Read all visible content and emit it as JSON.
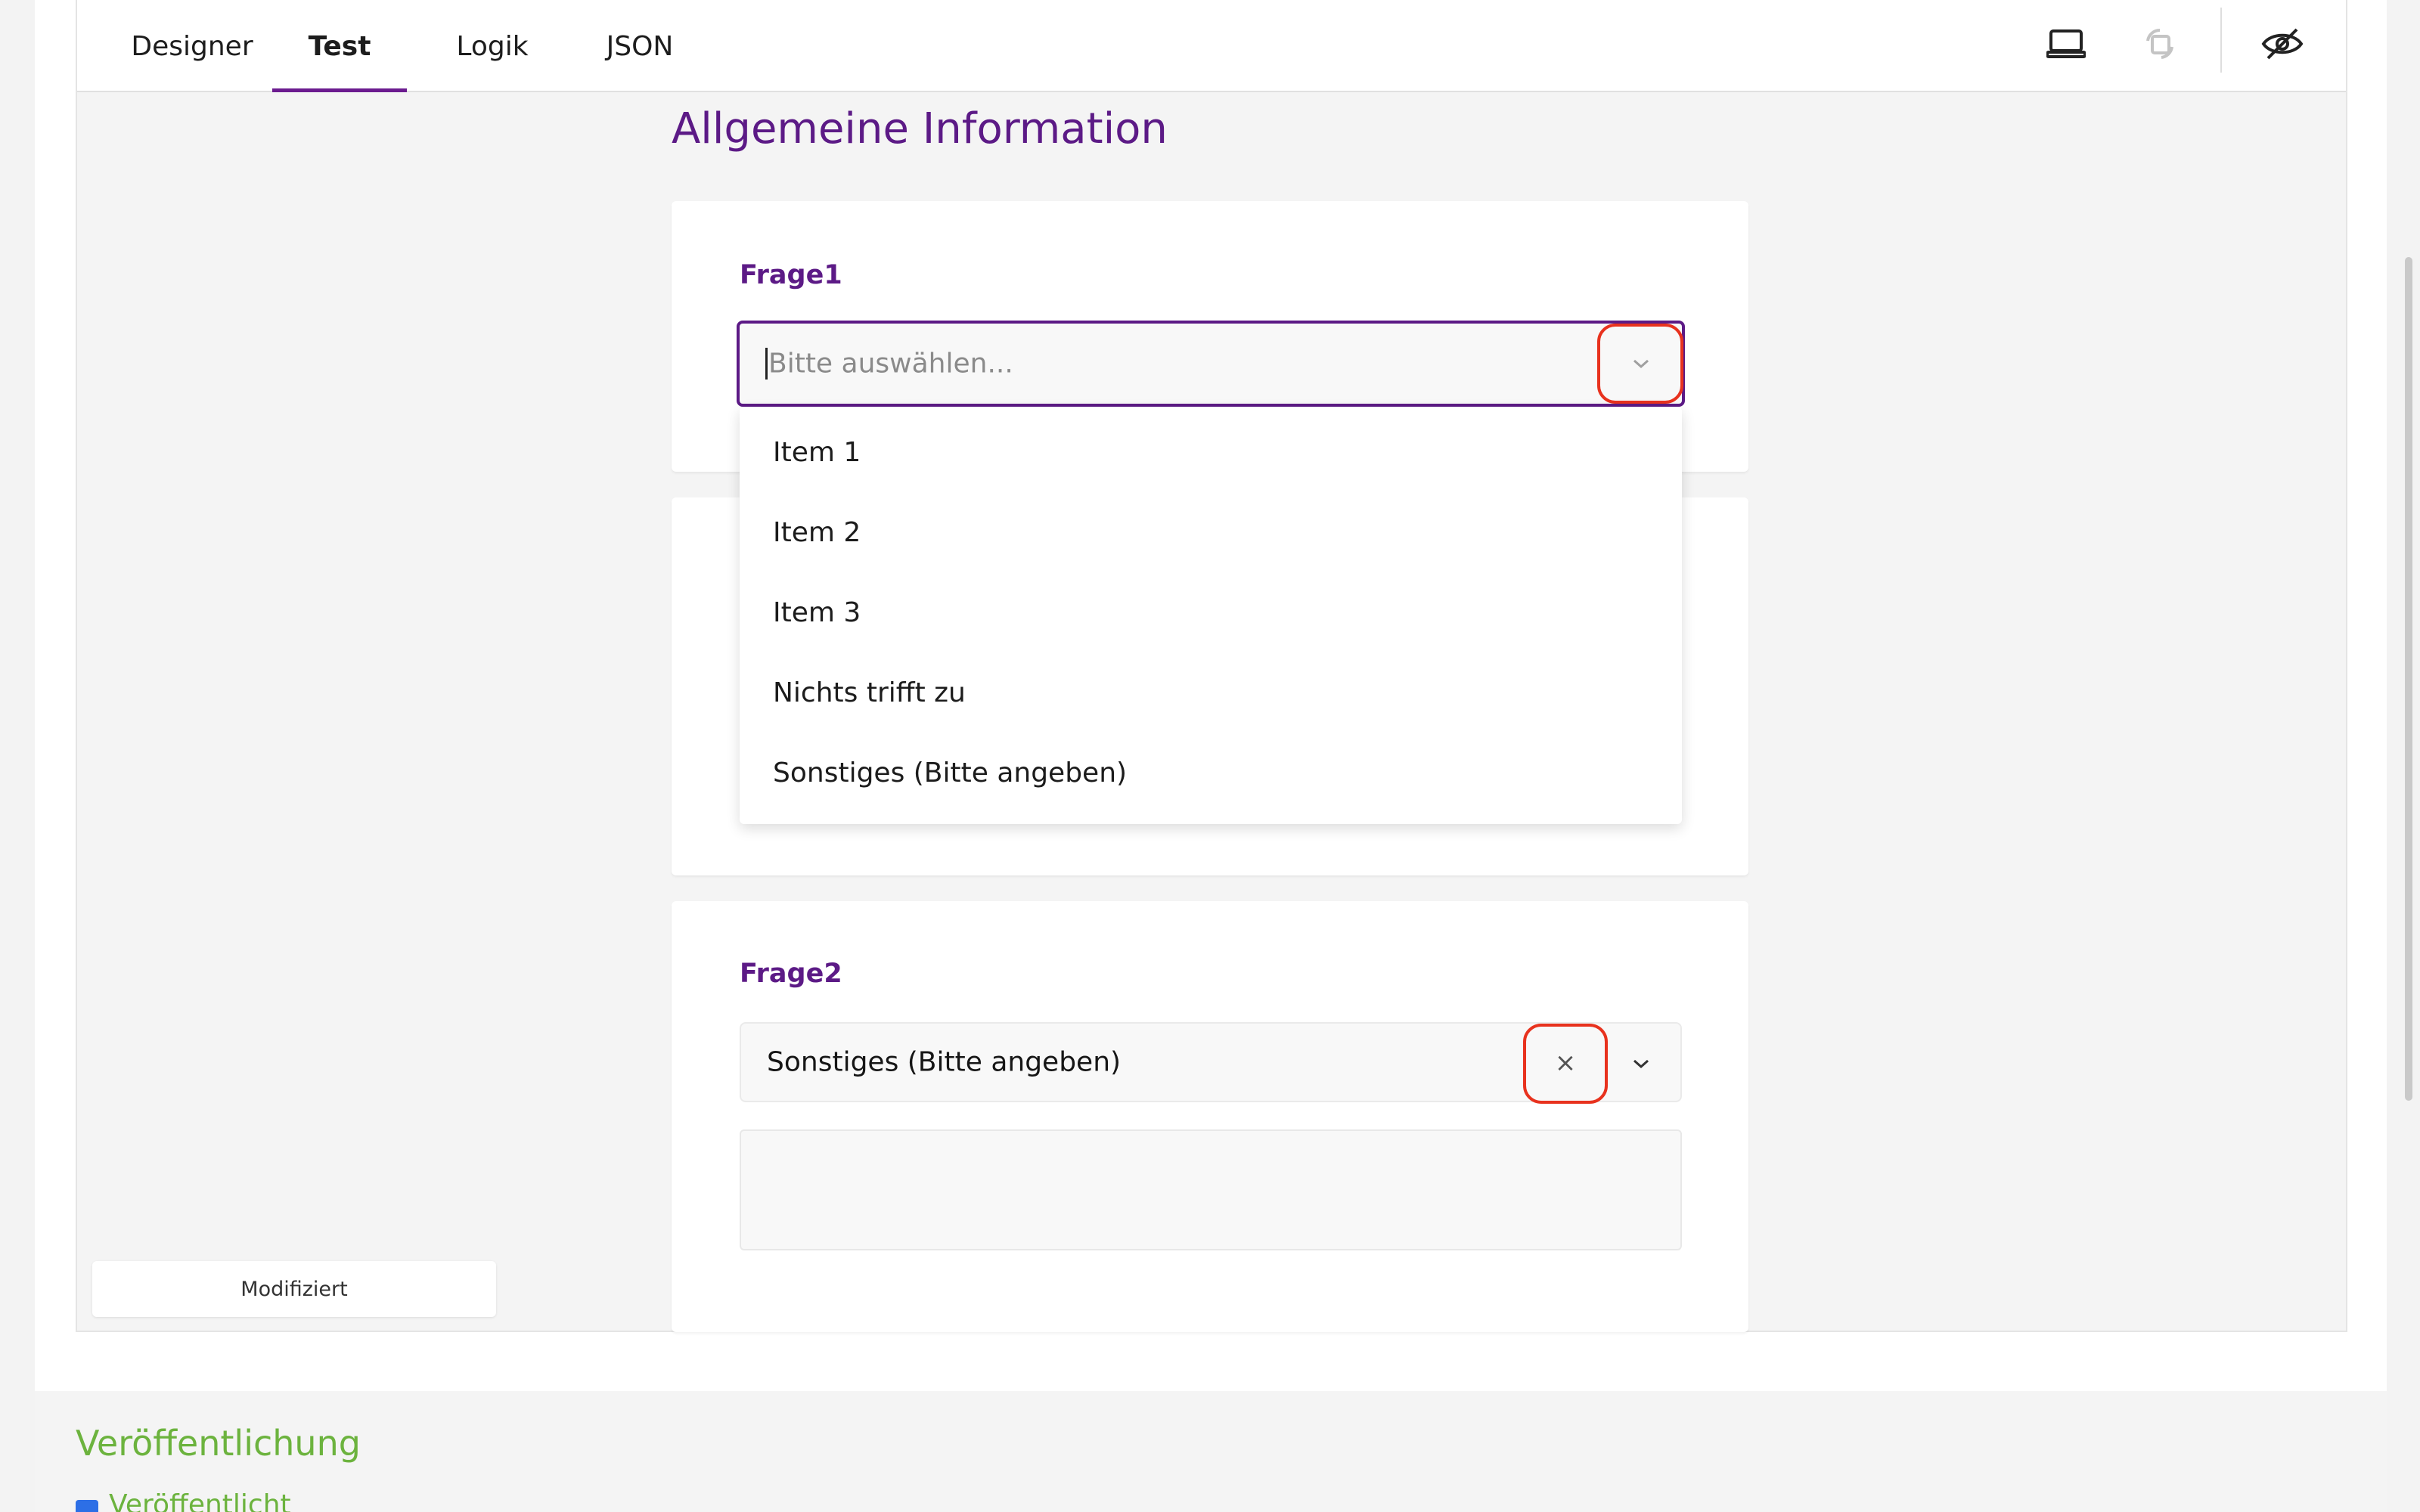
{
  "tabs": [
    {
      "label": "Designer",
      "active": false
    },
    {
      "label": "Test",
      "active": true
    },
    {
      "label": "Logik",
      "active": false
    },
    {
      "label": "JSON",
      "active": false
    }
  ],
  "toolbar": {
    "icons": [
      "laptop-icon",
      "orientation-icon",
      "hide-icon"
    ]
  },
  "section": {
    "title": "Allgemeine Information"
  },
  "question1": {
    "label": "Frage1",
    "placeholder": "Bitte auswählen...",
    "options": [
      "Item 1",
      "Item 2",
      "Item 3",
      "Nichts trifft zu",
      "Sonstiges (Bitte angeben)"
    ]
  },
  "question2": {
    "label": "Frage2",
    "selected": "Sonstiges (Bitte angeben)",
    "clear_symbol": "×"
  },
  "status": {
    "label": "Modifiziert"
  },
  "publish": {
    "title": "Veröffentlichung",
    "checkbox_label": "Veröffentlicht",
    "checked": true
  },
  "colors": {
    "accent": "#5c1a86",
    "highlight": "#e8321e",
    "publish_green": "#6cb33e"
  }
}
